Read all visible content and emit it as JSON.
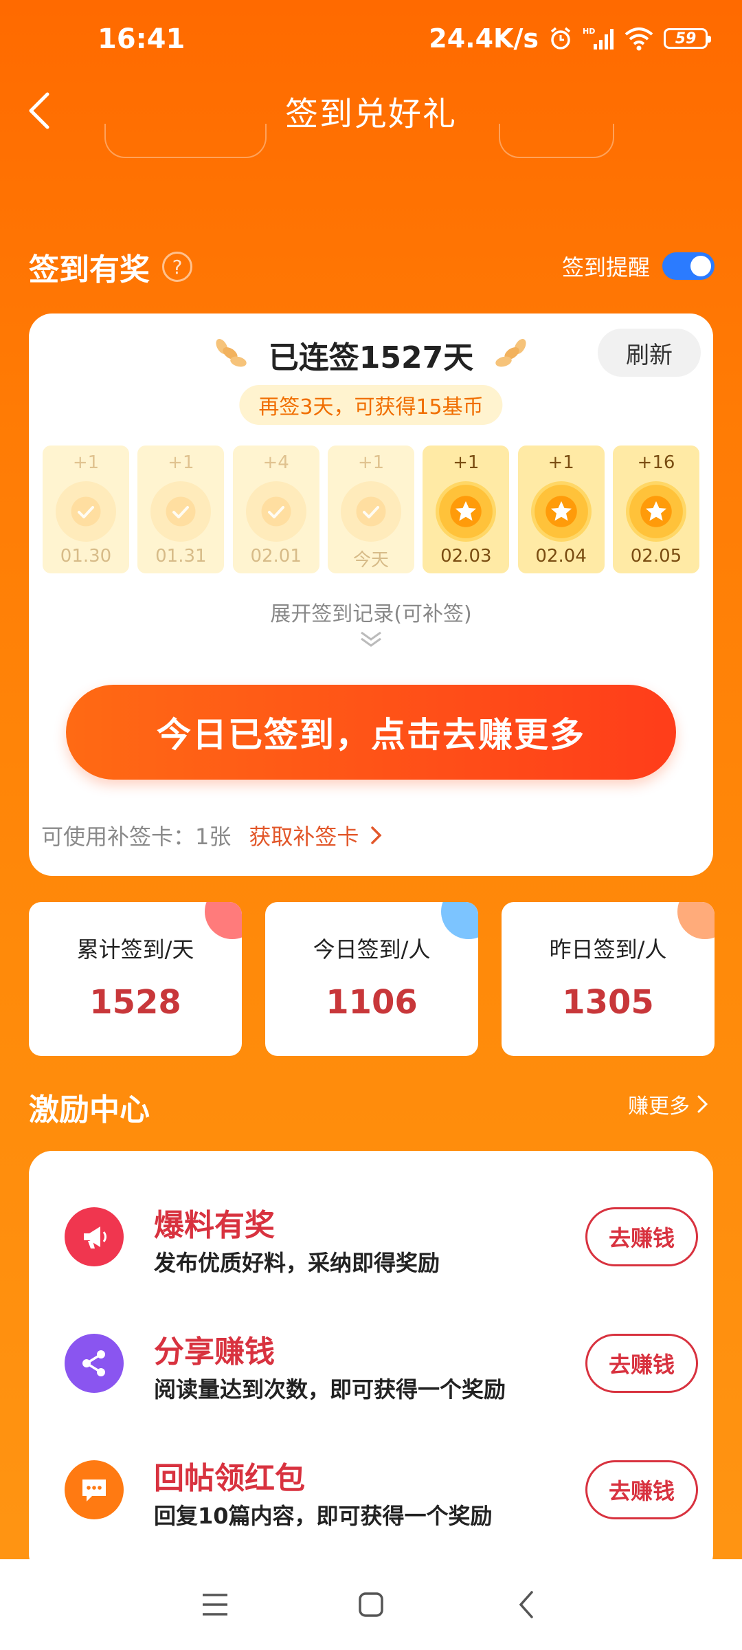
{
  "status_bar": {
    "time": "16:41",
    "network_speed": "24.4K/s",
    "battery": "59"
  },
  "header": {
    "title": "签到兑好礼"
  },
  "checkin": {
    "section_title": "签到有奖",
    "reminder_label": "签到提醒",
    "reminder_on": true,
    "streak_text": "已连签1527天",
    "refresh_label": "刷新",
    "bonus_tip": "再签3天，可获得15基币",
    "days": [
      {
        "bonus": "+1",
        "date": "01.30",
        "status": "done"
      },
      {
        "bonus": "+1",
        "date": "01.31",
        "status": "done"
      },
      {
        "bonus": "+4",
        "date": "02.01",
        "status": "done"
      },
      {
        "bonus": "+1",
        "date": "今天",
        "status": "done"
      },
      {
        "bonus": "+1",
        "date": "02.03",
        "status": "upcoming"
      },
      {
        "bonus": "+1",
        "date": "02.04",
        "status": "upcoming"
      },
      {
        "bonus": "+16",
        "date": "02.05",
        "status": "upcoming"
      }
    ],
    "expand_label": "展开签到记录(可补签)",
    "cta_label": "今日已签到，点击去赚更多",
    "makeup_label": "可使用补签卡：1张",
    "makeup_link": "获取补签卡"
  },
  "stats": [
    {
      "label": "累计签到/天",
      "value": "1528",
      "accent": "#ff7b7b"
    },
    {
      "label": "今日签到/人",
      "value": "1106",
      "accent": "#7cc4ff"
    },
    {
      "label": "昨日签到/人",
      "value": "1305",
      "accent": "#ffab7a"
    }
  ],
  "incentive": {
    "section_title": "激励中心",
    "more_label": "赚更多",
    "tasks": [
      {
        "title": "爆料有奖",
        "desc": "发布优质好料，采纳即得奖励",
        "button": "去赚钱",
        "icon": "megaphone-icon",
        "color": "#f0364f"
      },
      {
        "title": "分享赚钱",
        "desc": "阅读量达到次数，即可获得一个奖励",
        "button": "去赚钱",
        "icon": "share-icon",
        "color": "#8a55f0"
      },
      {
        "title": "回帖领红包",
        "desc": "回复10篇内容，即可获得一个奖励",
        "button": "去赚钱",
        "icon": "comment-icon",
        "color": "#ff7a12"
      }
    ]
  },
  "colors": {
    "primary": "#ff6a00",
    "accent_red": "#d8323f",
    "toggle_blue": "#2b7bff"
  }
}
